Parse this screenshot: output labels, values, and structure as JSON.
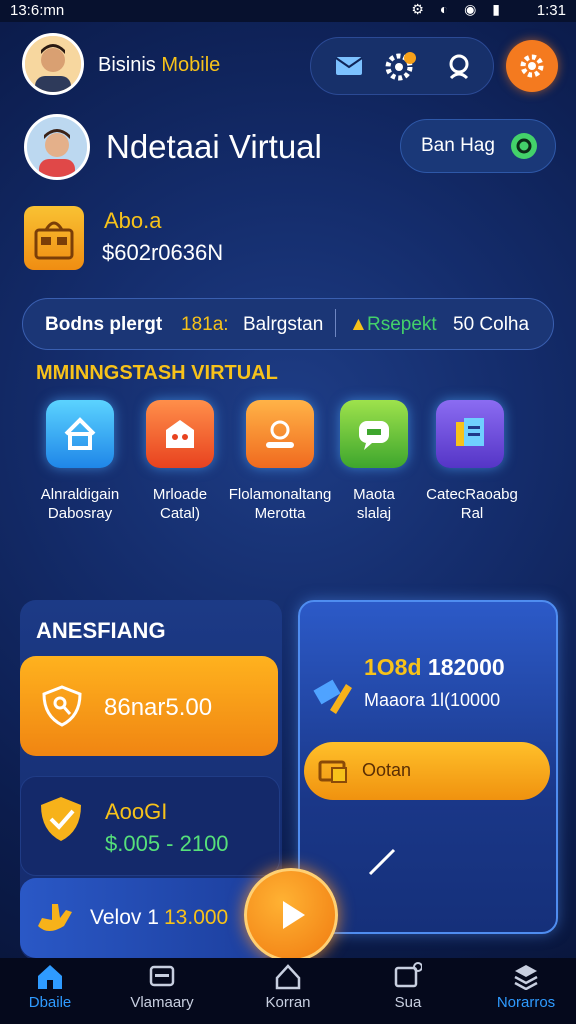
{
  "status": {
    "time": "13:6:mn",
    "right_time": "1:31"
  },
  "header": {
    "title": "Bisinis",
    "title_highlight": "Mobile"
  },
  "profile": {
    "name": "Ndetaai Virtual",
    "ban_button": "Ban Hag"
  },
  "balance": {
    "label": "Abo.a",
    "value": "$602r0636N"
  },
  "info_bar": {
    "text1": "Bodns plergt",
    "text2": "181a:",
    "text3": "Balrgstan",
    "text4": "Rsepekt",
    "text5": "50 Colha"
  },
  "section_title": "MMINNGSTASH VIRTUAL",
  "features": [
    {
      "label1": "Alnraldigain",
      "label2": "Dabosray"
    },
    {
      "label1": "Mrloade",
      "label2": "Catal)"
    },
    {
      "label1": "Flolamonaltang",
      "label2": "Merotta"
    },
    {
      "label1": "Maota",
      "label2": "slalaj"
    },
    {
      "label1": "CatecRaoabg",
      "label2": "Ral"
    }
  ],
  "left_panel": {
    "title": "ANESFIANG",
    "card1_value": "86nar5.00",
    "card2_label": "AooGI",
    "card2_value": "$.005 - 2100",
    "card3_label": "Velov 1",
    "card3_value": "13.000"
  },
  "right_panel": {
    "line1_prefix": "1O8d",
    "line1_value": "182000",
    "line2": "Maaora 1l(10000",
    "button": "Ootan"
  },
  "nav": [
    {
      "label": "Dbaile"
    },
    {
      "label": "Vlamaary"
    },
    {
      "label": "Korran"
    },
    {
      "label": "Sua"
    },
    {
      "label": "Norarros"
    }
  ],
  "colors": {
    "accent": "#f7a11a",
    "yellow": "#f7c21a",
    "nav_active": "#2f9bff",
    "green": "#43d16a"
  }
}
